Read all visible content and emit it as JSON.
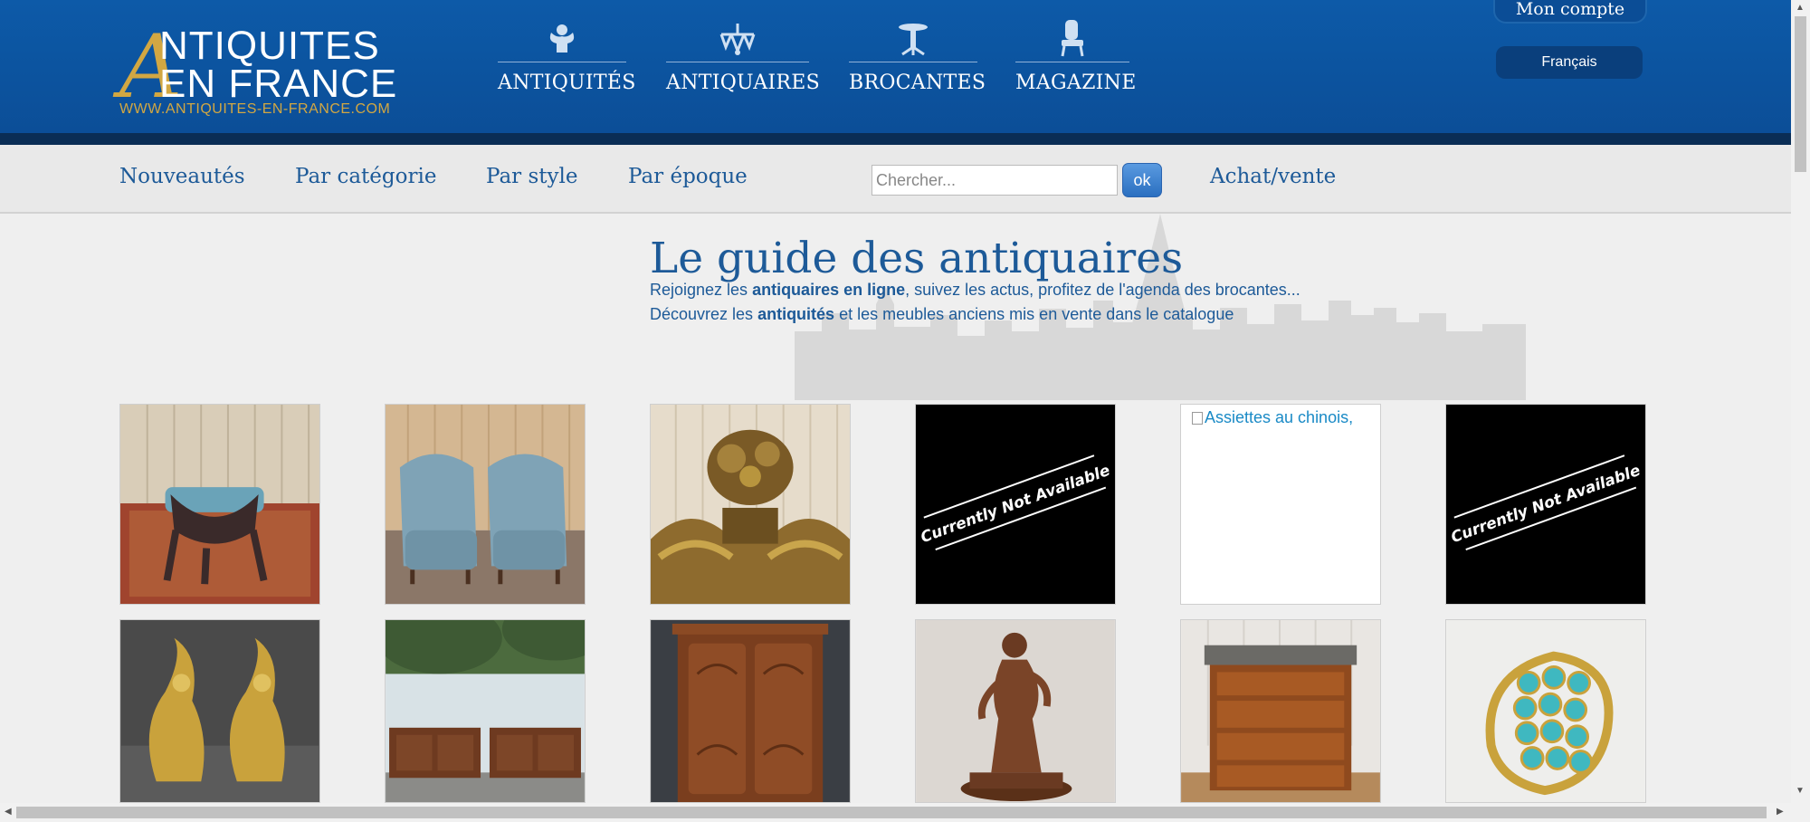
{
  "header": {
    "logo": {
      "big_letter": "A",
      "line1": "NTIQUITES",
      "line2": "EN FRANCE",
      "url": "WWW.ANTIQUITES-EN-FRANCE.COM"
    },
    "main_nav": [
      {
        "label": "ANTIQUITÉS",
        "icon": "cherub-icon"
      },
      {
        "label": "ANTIQUAIRES",
        "icon": "chandelier-icon"
      },
      {
        "label": "BROCANTES",
        "icon": "pedestal-table-icon"
      },
      {
        "label": "MAGAZINE",
        "icon": "armchair-icon"
      }
    ],
    "account_label": "Mon compte",
    "language_label": "Français"
  },
  "subnav": {
    "items": [
      "Nouveautés",
      "Par catégorie",
      "Par style",
      "Par époque"
    ],
    "search_placeholder": "Chercher...",
    "search_button": "ok",
    "achat_vente": "Achat/vente"
  },
  "guide": {
    "title": "Le guide des antiquaires",
    "line1": {
      "pre": "Rejoignez les ",
      "bold": "antiquaires en ligne",
      "post": ", suivez les actus, profitez de l'agenda des brocantes..."
    },
    "line2": {
      "pre": "Découvrez les ",
      "bold": "antiquités",
      "post": " et les meubles anciens mis en vente dans le catalogue"
    }
  },
  "products": [
    {
      "type": "photo",
      "subject": "chair-back-on-rug"
    },
    {
      "type": "photo",
      "subject": "pair-of-blue-armchairs"
    },
    {
      "type": "photo",
      "subject": "gilded-carved-pediment"
    },
    {
      "type": "unavailable",
      "label": "Currently Not Available"
    },
    {
      "type": "broken",
      "alt": "Assiettes au chinois,"
    },
    {
      "type": "unavailable",
      "label": "Currently Not Available"
    },
    {
      "type": "photo",
      "subject": "bronze-andirons"
    },
    {
      "type": "photo",
      "subject": "pair-of-wooden-buffets"
    },
    {
      "type": "photo",
      "subject": "wooden-armoire"
    },
    {
      "type": "photo",
      "subject": "bronze-statue"
    },
    {
      "type": "photo",
      "subject": "marble-top-chest-of-drawers"
    },
    {
      "type": "photo",
      "subject": "turquoise-gold-ring"
    }
  ],
  "colors": {
    "header_blue": "#0b4d96",
    "gold": "#d2a742",
    "link_blue": "#1d5a98"
  }
}
